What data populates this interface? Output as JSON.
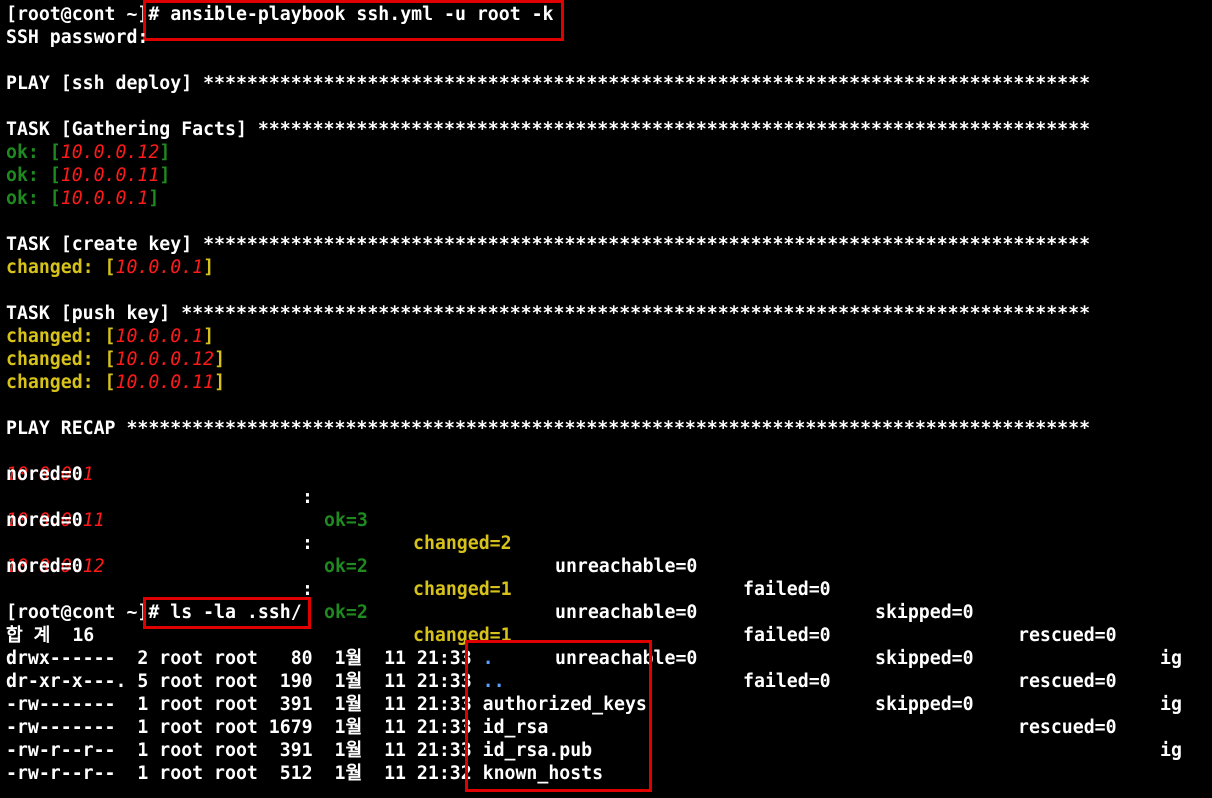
{
  "colors": {
    "background": "#000000",
    "text": "#ffffff",
    "ok": "#1f8a1f",
    "changed": "#d7c21a",
    "ip": "#ff1a1a",
    "dir": "#5aa0ff",
    "highlight": "#e00000"
  },
  "cmd1": {
    "prompt": "[root@cont ~]",
    "command": "# ansible-playbook ssh.yml -u root -k"
  },
  "ssh_password": "SSH password:",
  "play_header": "PLAY [ssh deploy] *********************************************************************************",
  "task_facts": {
    "header": "TASK [Gathering Facts] ****************************************************************************",
    "results": [
      {
        "status": "ok: [",
        "ip": "10.0.0.12",
        "close": "]"
      },
      {
        "status": "ok: [",
        "ip": "10.0.0.11",
        "close": "]"
      },
      {
        "status": "ok: [",
        "ip": "10.0.0.1",
        "close": "]"
      }
    ]
  },
  "task_create": {
    "header": "TASK [create key] *********************************************************************************",
    "results": [
      {
        "status": "changed: [",
        "ip": "10.0.0.1",
        "close": "]"
      }
    ]
  },
  "task_push": {
    "header": "TASK [push key] ***********************************************************************************",
    "results": [
      {
        "status": "changed: [",
        "ip": "10.0.0.1",
        "close": "]"
      },
      {
        "status": "changed: [",
        "ip": "10.0.0.12",
        "close": "]"
      },
      {
        "status": "changed: [",
        "ip": "10.0.0.11",
        "close": "]"
      }
    ]
  },
  "recap": {
    "header": "PLAY RECAP ****************************************************************************************",
    "rows": [
      {
        "host": "10.0.0.1",
        "colon": ":",
        "ok": "ok=3",
        "changed": "changed=2",
        "unreachable": "unreachable=0",
        "failed": "failed=0",
        "skipped": "skipped=0",
        "rescued": "rescued=0",
        "ig": "ig",
        "ignored_tail": "nored=0"
      },
      {
        "host": "10.0.0.11",
        "colon": ":",
        "ok": "ok=2",
        "changed": "changed=1",
        "unreachable": "unreachable=0",
        "failed": "failed=0",
        "skipped": "skipped=0",
        "rescued": "rescued=0",
        "ig": "ig",
        "ignored_tail": "nored=0"
      },
      {
        "host": "10.0.0.12",
        "colon": ":",
        "ok": "ok=2",
        "changed": "changed=1",
        "unreachable": "unreachable=0",
        "failed": "failed=0",
        "skipped": "skipped=0",
        "rescued": "rescued=0",
        "ig": "ig",
        "ignored_tail": "nored=0"
      }
    ]
  },
  "cmd2": {
    "prompt": "[root@cont ~]",
    "command": "# ls -la .ssh/"
  },
  "total_line": "합 계  16",
  "ls": [
    {
      "meta": "drwx------  2 root root   80  1월  11 21:33 ",
      "name": ".",
      "is_dir": true
    },
    {
      "meta": "dr-xr-x---. 5 root root  190  1월  11 21:33 ",
      "name": "..",
      "is_dir": true
    },
    {
      "meta": "-rw-------  1 root root  391  1월  11 21:33 ",
      "name": "authorized_keys",
      "is_dir": false
    },
    {
      "meta": "-rw-------  1 root root 1679  1월  11 21:33 ",
      "name": "id_rsa",
      "is_dir": false
    },
    {
      "meta": "-rw-r--r--  1 root root  391  1월  11 21:33 ",
      "name": "id_rsa.pub",
      "is_dir": false
    },
    {
      "meta": "-rw-r--r--  1 root root  512  1월  11 21:32 ",
      "name": "known_hosts",
      "is_dir": false
    }
  ]
}
